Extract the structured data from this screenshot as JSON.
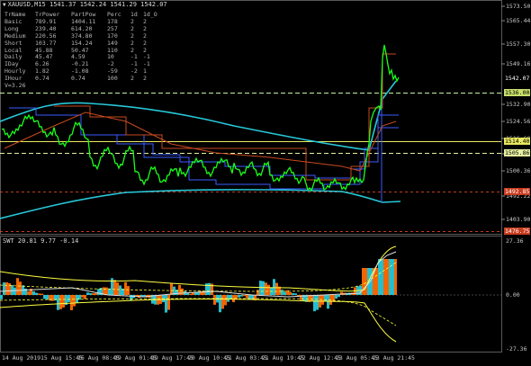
{
  "header": {
    "symbol_line": "XAUUSD,M15  1541.37 1542.24 1541.29 1542.07"
  },
  "table": {
    "columns": [
      "TrName",
      "TrPower",
      "PartPow",
      "Perc",
      "1d",
      "1d_O"
    ],
    "rows": [
      [
        "Basic",
        "789.91",
        "1404.11",
        "178",
        "2",
        "2"
      ],
      [
        "Long",
        "239.40",
        "614.20",
        "257",
        "2",
        "2"
      ],
      [
        "Medium",
        "220.56",
        "374.80",
        "170",
        "2",
        "2"
      ],
      [
        "Short",
        "103.77",
        "154.24",
        "149",
        "2",
        "2"
      ],
      [
        "Local",
        "45.88",
        "50.47",
        "110",
        "2",
        "2"
      ],
      [
        "Daily",
        "45.47",
        "4.59",
        "10",
        "-1",
        "-1"
      ],
      [
        "IDay",
        "6.26",
        "-0.21",
        "-2",
        "-1",
        "-1"
      ],
      [
        "Hourly",
        "1.82",
        "-1.08",
        "-59",
        "-2",
        "1"
      ],
      [
        "IHour",
        "0.74",
        "0.74",
        "100",
        "2",
        "2"
      ]
    ],
    "footer": "V=3.26"
  },
  "price_axis": {
    "labels": [
      "1573.50",
      "1565.44",
      "1557.30",
      "1549.16",
      "1532.90",
      "1524.56",
      "1516.60",
      "1508.48",
      "1500.36",
      "1492.22",
      "1403.90"
    ],
    "tags": [
      {
        "text": "1542.07",
        "color": "#ffffff",
        "bg": "#000000"
      },
      {
        "text": "1536.00",
        "color": "#000000",
        "bg": "#c8e06a"
      },
      {
        "text": "1514.40",
        "color": "#000000",
        "bg": "#e8e860"
      },
      {
        "text": "1505.86",
        "color": "#000000",
        "bg": "#e6f0a0"
      },
      {
        "text": "1492.85",
        "color": "#ffffff",
        "bg": "#c83c1e"
      },
      {
        "text": "1476.75",
        "color": "#ffffff",
        "bg": "#c83c1e"
      }
    ]
  },
  "oscillator": {
    "title": "SWT 20.81 9.77 -0.14",
    "labels": [
      "27.36",
      "0.00",
      "-27.36"
    ]
  },
  "time_axis": [
    "14 Aug 2019",
    "15 Aug 15:45",
    "16 Aug 08:45",
    "19 Aug 01:45",
    "19 Aug 17:45",
    "20 Aug 10:45",
    "21 Aug 03:45",
    "21 Aug 19:45",
    "22 Aug 12:45",
    "23 Aug 05:45",
    "23 Aug 21:45"
  ],
  "colors": {
    "price": "#19ff19",
    "cyan": "#27c8d8",
    "yellow": "#ffff40",
    "dashed": "#c8f0a0",
    "blue": "#3a5cff",
    "orange": "#ff6a00",
    "red_dashed": "#c83c1e",
    "background": "#000000"
  }
}
